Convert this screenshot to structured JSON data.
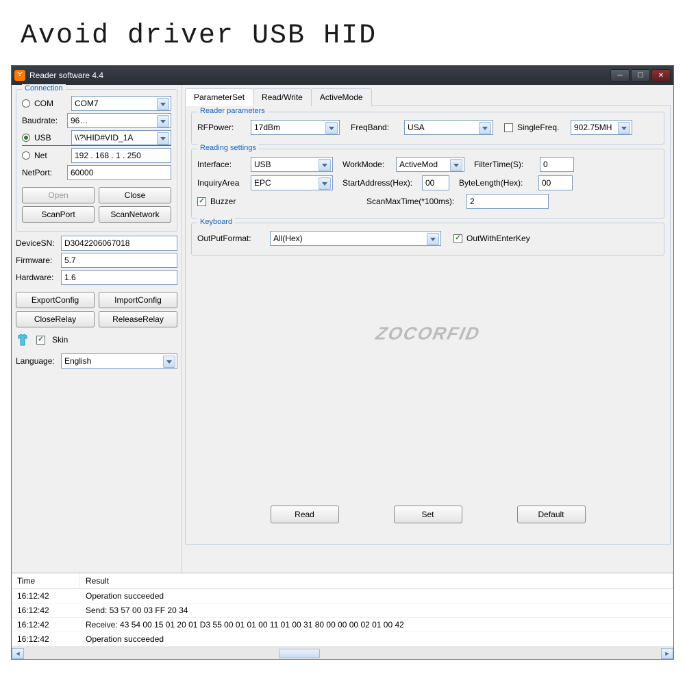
{
  "pageHeading": "Avoid driver USB HID",
  "window": {
    "title": "Reader software 4.4"
  },
  "connection": {
    "legend": "Connection",
    "com": {
      "label": "COM",
      "value": "COM7",
      "selected": false
    },
    "baudrate": {
      "label": "Baudrate:",
      "value": "96…"
    },
    "usb": {
      "label": "USB",
      "value": "\\\\?\\HID#VID_1A",
      "selected": true
    },
    "net": {
      "label": "Net",
      "value": "192 . 168 .  1  . 250",
      "selected": false
    },
    "netport": {
      "label": "NetPort:",
      "value": "60000"
    },
    "open": "Open",
    "close": "Close",
    "scanport": "ScanPort",
    "scannet": "ScanNetwork"
  },
  "device": {
    "sn": {
      "label": "DeviceSN:",
      "value": "D3042206067018"
    },
    "fw": {
      "label": "Firmware:",
      "value": "5.7"
    },
    "hw": {
      "label": "Hardware:",
      "value": "1.6"
    }
  },
  "cfg": {
    "export": "ExportConfig",
    "import": "ImportConfig",
    "closerelay": "CloseRelay",
    "releaserelay": "ReleaseRelay"
  },
  "skin": {
    "label": "Skin",
    "checked": true
  },
  "language": {
    "label": "Language:",
    "value": "English"
  },
  "tabs": {
    "param": "ParameterSet",
    "rw": "Read/Write",
    "active": "ActiveMode"
  },
  "reader": {
    "legend": "Reader parameters",
    "rfpower": {
      "label": "RFPower:",
      "value": "17dBm"
    },
    "freqband": {
      "label": "FreqBand:",
      "value": "USA"
    },
    "singlefreq": {
      "label": "SingleFreq.",
      "value": "902.75MH",
      "checked": false
    }
  },
  "reading": {
    "legend": "Reading settings",
    "iface": {
      "label": "Interface:",
      "value": "USB"
    },
    "workmode": {
      "label": "WorkMode:",
      "value": "ActiveMod"
    },
    "filtertime": {
      "label": "FilterTime(S):",
      "value": "0"
    },
    "inqarea": {
      "label": "InquiryArea",
      "value": "EPC"
    },
    "startaddr": {
      "label": "StartAddress(Hex):",
      "value": "00"
    },
    "bytelen": {
      "label": "ByteLength(Hex):",
      "value": "00"
    },
    "buzzer": {
      "label": "Buzzer",
      "checked": true
    },
    "scanmax": {
      "label": "ScanMaxTime(*100ms):",
      "value": "2"
    }
  },
  "keyboard": {
    "legend": "Keyboard",
    "format": {
      "label": "OutPutFormat:",
      "value": "All(Hex)"
    },
    "enter": {
      "label": "OutWithEnterKey",
      "checked": true
    }
  },
  "watermark": "ZOCORFID",
  "actions": {
    "read": "Read",
    "set": "Set",
    "def": "Default"
  },
  "log": {
    "cols": {
      "time": "Time",
      "result": "Result"
    },
    "rows": [
      {
        "time": "16:12:42",
        "result": "Operation succeeded"
      },
      {
        "time": "16:12:42",
        "result": "Send: 53 57 00 03 FF 20 34"
      },
      {
        "time": "16:12:42",
        "result": "Receive: 43 54 00 15 01 20 01 D3 55 00 01 01 00 11 01 00 31 80 00 00 00 02 01 00 42"
      },
      {
        "time": "16:12:42",
        "result": "Operation succeeded"
      }
    ]
  }
}
